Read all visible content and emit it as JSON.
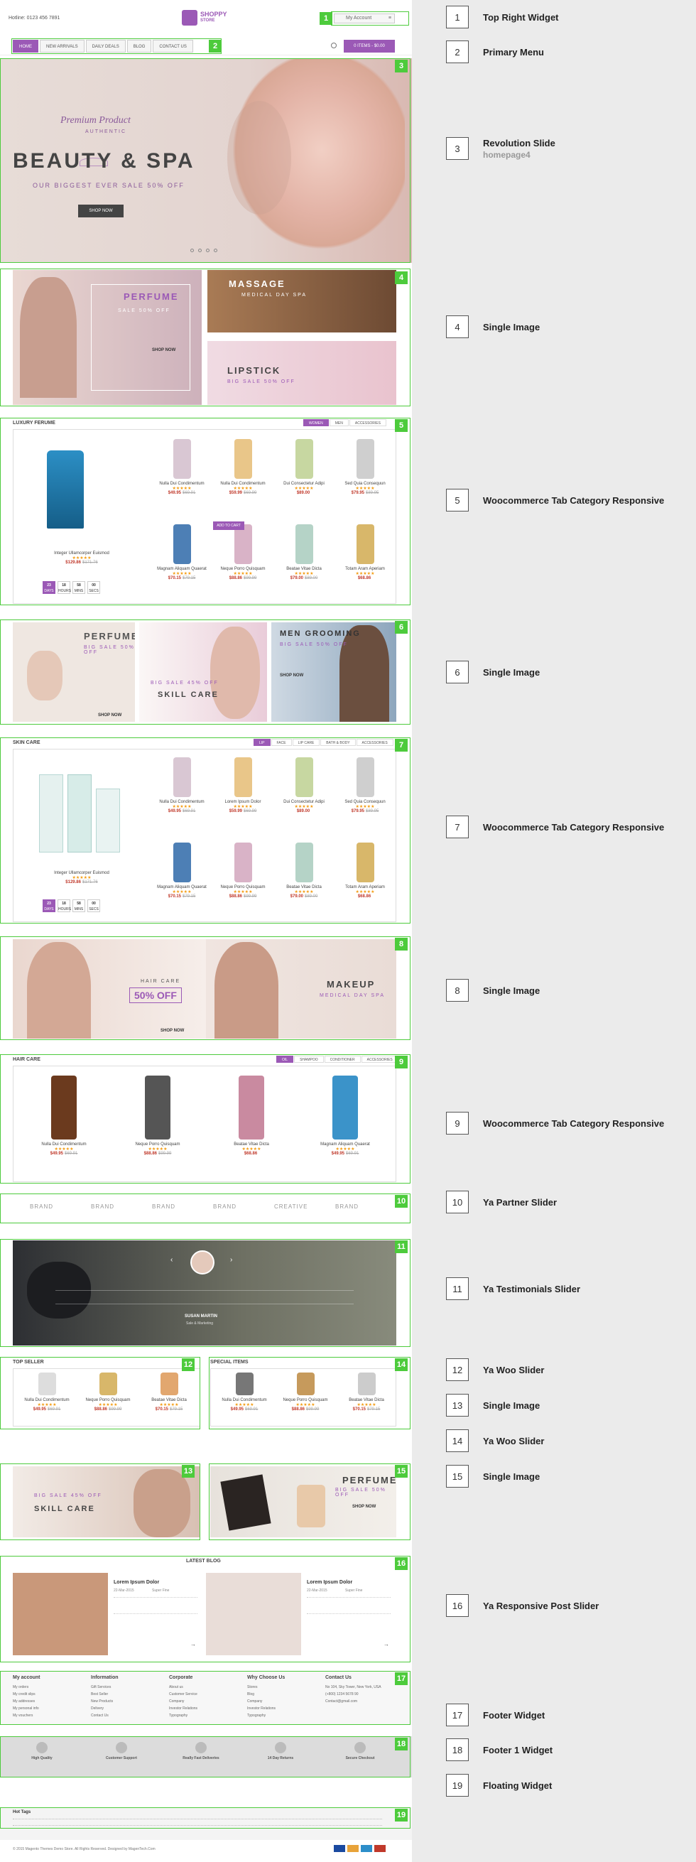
{
  "header": {
    "hotline": "Hotline: 0123 456 7891",
    "logo_text": "SHOPPY",
    "logo_sub": "STORE",
    "account_label": "My Account"
  },
  "menu": {
    "items": [
      "HOME",
      "NEW ARRIVALS",
      "DAILY DEALS",
      "BLOG",
      "CONTACT US"
    ],
    "cart": "0 ITEMS - $0.00"
  },
  "slider": {
    "premium": "Premium Product",
    "authentic": "AUTHENTIC",
    "title": "BEAUTY & SPA",
    "sale": "OUR BIGGEST EVER SALE 50% OFF",
    "shop": "SHOP NOW"
  },
  "banners1": {
    "perfume": "PERFUME",
    "perfume_sale": "SALE 50% OFF",
    "perfume_shop": "SHOP NOW",
    "massage": "MASSAGE",
    "massage_sub": "MEDICAL DAY SPA",
    "lipstick": "LIPSTICK",
    "lipstick_sale": "BIG SALE 50% OFF"
  },
  "luxury": {
    "title": "LUXURY FERUME",
    "tabs": [
      "WOMEN",
      "MEN",
      "ACCESSORIES"
    ],
    "featured": {
      "name": "Integer Ullamcorper Euismod",
      "price": "$129.86",
      "old": "$171.76"
    },
    "countdown": [
      {
        "v": "23",
        "l": "DAYS"
      },
      {
        "v": "18",
        "l": "HOURS"
      },
      {
        "v": "58",
        "l": "MINS"
      },
      {
        "v": "00",
        "l": "SECS"
      }
    ],
    "products": [
      {
        "name": "Nulla Dui Condimentum",
        "price": "$49.95",
        "old": "$69.91"
      },
      {
        "name": "Nulla Dui Condimentum",
        "price": "$59.99",
        "old": "$69.99"
      },
      {
        "name": "Dui Consectetur Adipi",
        "price": "$89.00",
        "old": ""
      },
      {
        "name": "Sed Quia Consequun",
        "price": "$79.95",
        "old": "$89.95"
      },
      {
        "name": "Magnam Aliquam Quaerat",
        "price": "$70.15",
        "old": "$79.15"
      },
      {
        "name": "Neque Porro Quisquam",
        "price": "$88.86",
        "old": "$99.99"
      },
      {
        "name": "Beatae Vitae Dicta",
        "price": "$79.00",
        "old": "$89.00"
      },
      {
        "name": "Totam Aram Aperiam",
        "price": "$68.86",
        "old": ""
      }
    ],
    "add_to_cart": "ADD TO CART"
  },
  "banners2": {
    "perfume": "PERFUME",
    "perfume_sale": "BIG SALE 50% OFF",
    "perfume_shop": "SHOP NOW",
    "skill_sale": "BIG SALE 45% OFF",
    "skill": "SKILL CARE",
    "men": "MEN GROOMING",
    "men_sale": "BIG SALE 50% OFF",
    "men_shop": "SHOP NOW"
  },
  "skin": {
    "title": "SKIN CARE",
    "tabs": [
      "LIP",
      "FACE",
      "LIP CARE",
      "BATH & BODY",
      "ACCESSORIES"
    ],
    "featured": {
      "name": "Integer Ullamcorper Euismod",
      "price": "$129.86",
      "old": "$171.76"
    },
    "countdown": [
      {
        "v": "23",
        "l": "DAYS"
      },
      {
        "v": "18",
        "l": "HOURS"
      },
      {
        "v": "58",
        "l": "MINS"
      },
      {
        "v": "00",
        "l": "SECS"
      }
    ],
    "products": [
      {
        "name": "Nulla Dui Condimentum",
        "price": "$49.95",
        "old": "$69.91"
      },
      {
        "name": "Lorem Ipsum Dolor",
        "price": "$59.99",
        "old": "$69.99"
      },
      {
        "name": "Dui Consectetur Adipi",
        "price": "$89.00",
        "old": ""
      },
      {
        "name": "Sed Quia Consequun",
        "price": "$79.95",
        "old": "$89.95"
      },
      {
        "name": "Magnam Aliquam Quaerat",
        "price": "$70.15",
        "old": "$79.15"
      },
      {
        "name": "Neque Porro Quisquam",
        "price": "$88.86",
        "old": "$99.99"
      },
      {
        "name": "Beatae Vitae Dicta",
        "price": "$79.00",
        "old": "$89.00"
      },
      {
        "name": "Totam Aram Aperiam",
        "price": "$68.86",
        "old": ""
      }
    ]
  },
  "banners3": {
    "hair_care": "HAIR CARE",
    "hair_off": "50% OFF",
    "hair_shop": "SHOP NOW",
    "makeup": "MAKEUP",
    "makeup_sub": "MEDICAL DAY SPA"
  },
  "hair": {
    "title": "HAIR CARE",
    "tabs": [
      "OIL",
      "SHAMPOO",
      "CONDITIONER",
      "ACCESSORIES"
    ],
    "products": [
      {
        "name": "Nulla Dui Condimentum",
        "price": "$49.95",
        "old": "$69.91"
      },
      {
        "name": "Neque Porro Quisquam",
        "price": "$88.86",
        "old": "$99.99"
      },
      {
        "name": "Beatae Vitae Dicta",
        "price": "$68.86",
        "old": ""
      },
      {
        "name": "Magnam Aliquam Quaerat",
        "price": "$49.95",
        "old": "$69.91"
      }
    ]
  },
  "partners": [
    "BRAND",
    "BRAND",
    "BRAND",
    "BRAND",
    "CREATIVE",
    "BRAND"
  ],
  "testimonial": {
    "author": "SUSAN MARTIN",
    "role": "Sale & Marketing"
  },
  "top_seller": {
    "title": "TOP SELLER",
    "products": [
      {
        "name": "Nulla Dui Condimentum",
        "price": "$49.95",
        "old": "$69.91"
      },
      {
        "name": "Neque Porro Quisquam",
        "price": "$88.86",
        "old": "$99.99"
      },
      {
        "name": "Beatae Vitae Dicta",
        "price": "$70.15",
        "old": "$79.15"
      }
    ]
  },
  "special": {
    "title": "SPECIAL ITEMS",
    "products": [
      {
        "name": "Nulla Dui Condimentum",
        "price": "$49.95",
        "old": "$69.91"
      },
      {
        "name": "Neque Porro Quisquam",
        "price": "$88.86",
        "old": "$99.99"
      },
      {
        "name": "Beatae Vitae Dicta",
        "price": "$70.15",
        "old": "$79.15"
      }
    ]
  },
  "banners4": {
    "skill_sale": "BIG SALE 45% OFF",
    "skill": "SKILL CARE",
    "perfume": "PERFUME",
    "perfume_sale": "BIG SALE 50% OFF",
    "perfume_shop": "SHOP NOW"
  },
  "blog": {
    "title": "LATEST BLOG",
    "posts": [
      {
        "title": "Lorem Ipsum Dolor",
        "date": "22-Mar-2015",
        "author": "Super Fine"
      },
      {
        "title": "Lorem Ipsum Dolor",
        "date": "22-Mar-2015",
        "author": "Super Fine"
      }
    ]
  },
  "footer": {
    "cols": [
      {
        "h": "My account",
        "items": [
          "My orders",
          "My credit slips",
          "My addresses",
          "My personal info",
          "My vouchers"
        ]
      },
      {
        "h": "Information",
        "items": [
          "Gift Services",
          "Best Seller",
          "New Products",
          "Delivery",
          "Contact Us"
        ]
      },
      {
        "h": "Corporate",
        "items": [
          "About us",
          "Customer Service",
          "Company",
          "Investor Relations",
          "Typography"
        ]
      },
      {
        "h": "Why Choose Us",
        "items": [
          "Stores",
          "Blog",
          "Company",
          "Investor Relations",
          "Typography"
        ]
      },
      {
        "h": "Contact Us",
        "items": [
          "No 104, Sky Tower, New York, USA",
          "(+800) 1234 5678 90",
          "Contact@gmail.com"
        ]
      }
    ],
    "services": [
      "High Quality",
      "Customer Support",
      "Really Fast Deliveries",
      "14 Day Returns",
      "Secure Checkout"
    ],
    "hot_tags": "Hot Tags",
    "copyright": "© 2015 Magento Themes Demo Store. All Rights Reserved. Designed by MagenTech.Com"
  },
  "legend": [
    {
      "n": "1",
      "label": "Top Right Widget"
    },
    {
      "n": "2",
      "label": "Primary Menu"
    },
    {
      "n": "3",
      "label": "Revolution Slide",
      "sub": "homepage4"
    },
    {
      "n": "4",
      "label": "Single Image"
    },
    {
      "n": "5",
      "label": "Woocommerce Tab Category Responsive"
    },
    {
      "n": "6",
      "label": "Single Image"
    },
    {
      "n": "7",
      "label": "Woocommerce Tab Category Responsive"
    },
    {
      "n": "8",
      "label": "Single Image"
    },
    {
      "n": "9",
      "label": "Woocommerce Tab Category Responsive"
    },
    {
      "n": "10",
      "label": "Ya Partner Slider"
    },
    {
      "n": "11",
      "label": "Ya Testimonials Slider"
    },
    {
      "n": "12",
      "label": "Ya Woo Slider"
    },
    {
      "n": "13",
      "label": "Single Image"
    },
    {
      "n": "14",
      "label": "Ya Woo Slider"
    },
    {
      "n": "15",
      "label": "Single Image"
    },
    {
      "n": "16",
      "label": "Ya Responsive  Post Slider"
    },
    {
      "n": "17",
      "label": "Footer Widget"
    },
    {
      "n": "18",
      "label": "Footer 1 Widget"
    },
    {
      "n": "19",
      "label": "Floating Widget"
    }
  ],
  "colors": {
    "accent": "#9b59b6",
    "outline": "#4dcb3c",
    "price": "#c0392b"
  }
}
